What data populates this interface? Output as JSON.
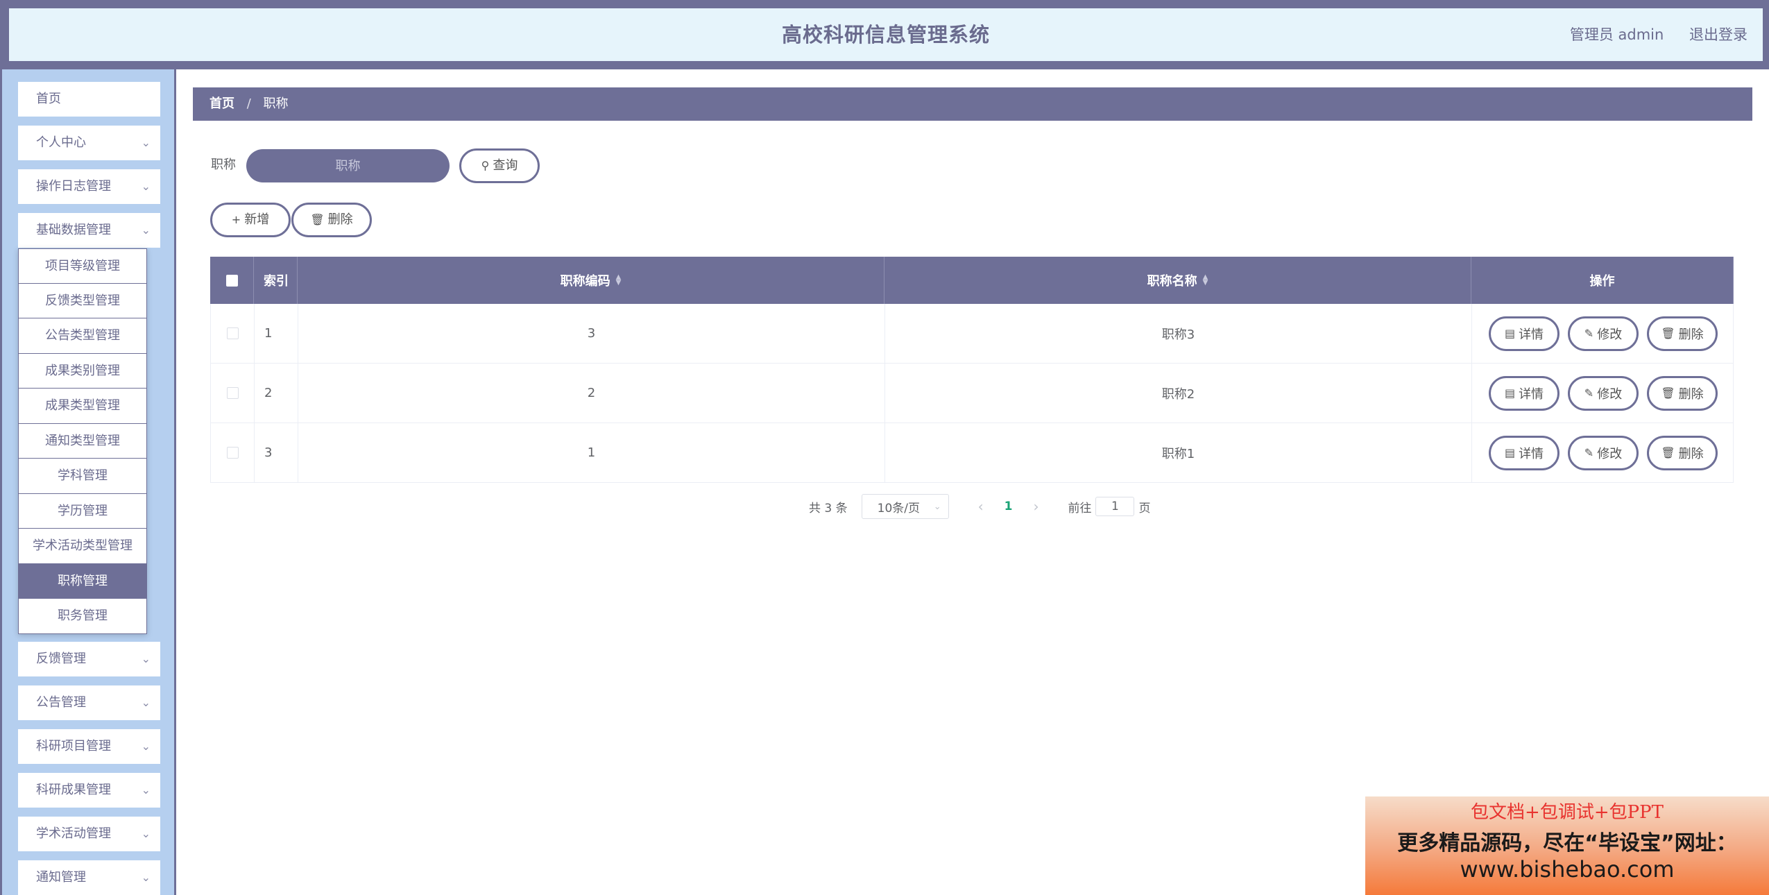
{
  "header": {
    "title": "高校科研信息管理系统",
    "user_label": "管理员 admin",
    "logout_label": "退出登录"
  },
  "sidebar": {
    "items_top": [
      {
        "label": "首页",
        "has_chevron": false
      },
      {
        "label": "个人中心",
        "has_chevron": true
      },
      {
        "label": "操作日志管理",
        "has_chevron": true
      },
      {
        "label": "基础数据管理",
        "has_chevron": true
      }
    ],
    "submenu": [
      {
        "label": "项目等级管理",
        "active": false
      },
      {
        "label": "反馈类型管理",
        "active": false
      },
      {
        "label": "公告类型管理",
        "active": false
      },
      {
        "label": "成果类别管理",
        "active": false
      },
      {
        "label": "成果类型管理",
        "active": false
      },
      {
        "label": "通知类型管理",
        "active": false
      },
      {
        "label": "学科管理",
        "active": false
      },
      {
        "label": "学历管理",
        "active": false
      },
      {
        "label": "学术活动类型管理",
        "active": false
      },
      {
        "label": "职称管理",
        "active": true
      },
      {
        "label": "职务管理",
        "active": false
      }
    ],
    "items_bottom": [
      {
        "label": "反馈管理"
      },
      {
        "label": "公告管理"
      },
      {
        "label": "科研项目管理"
      },
      {
        "label": "科研成果管理"
      },
      {
        "label": "学术活动管理"
      },
      {
        "label": "通知管理"
      }
    ]
  },
  "breadcrumb": {
    "home": "首页",
    "separator": "/",
    "current": "职称"
  },
  "search": {
    "label": "职称",
    "placeholder": "职称",
    "query_label": "查询"
  },
  "toolbar": {
    "add_label": "新增",
    "delete_label": "删除"
  },
  "table": {
    "columns": {
      "index": "索引",
      "code": "职称编码",
      "name": "职称名称",
      "ops": "操作"
    },
    "rows": [
      {
        "index": "1",
        "code": "3",
        "name": "职称3"
      },
      {
        "index": "2",
        "code": "2",
        "name": "职称2"
      },
      {
        "index": "3",
        "code": "1",
        "name": "职称1"
      }
    ],
    "row_actions": {
      "detail": "详情",
      "edit": "修改",
      "delete": "删除"
    }
  },
  "pagination": {
    "total_text": "共 3 条",
    "page_size": "10条/页",
    "current_page": "1",
    "goto_prefix": "前往",
    "goto_value": "1",
    "goto_suffix": "页"
  },
  "watermark": {
    "line1": "包文档+包调试+包PPT",
    "line2": "更多精品源码，尽在“毕设宝”网址：",
    "line3": "www.bishebao.com"
  },
  "colors": {
    "primary": "#6e6f97",
    "header_bg": "#e6f4fb",
    "sidebar_bg": "#b5cfef",
    "active_page": "#1aa376",
    "watermark_red": "#e8332f"
  }
}
